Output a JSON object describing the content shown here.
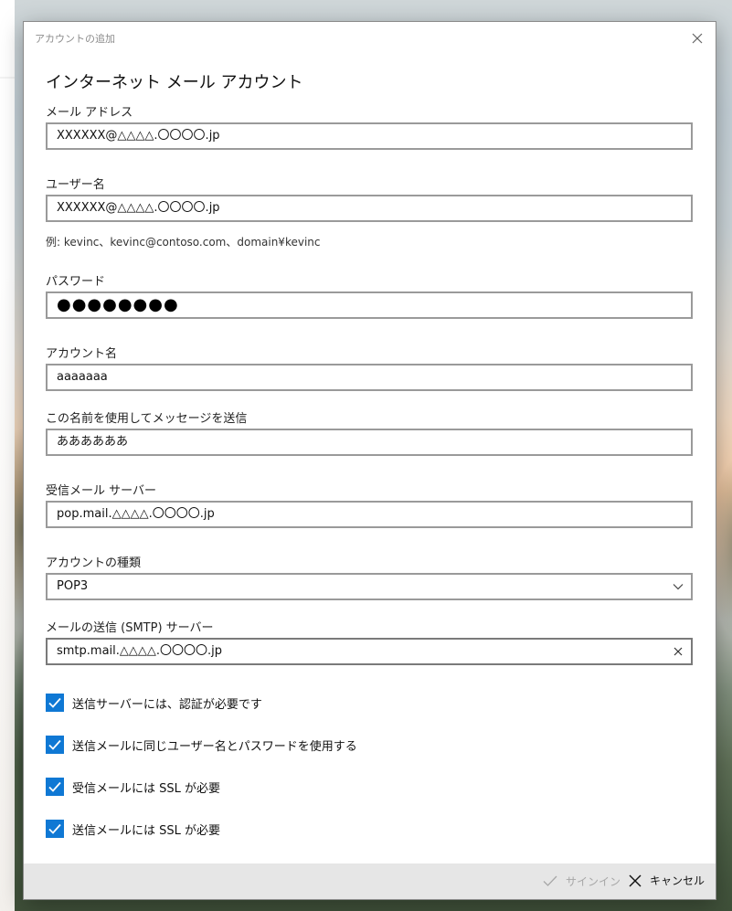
{
  "window": {
    "title": "アカウントの追加"
  },
  "dialog": {
    "heading": "インターネット メール アカウント",
    "fields": {
      "email": {
        "label": "メール アドレス",
        "value": "XXXXXX@△△△△.〇〇〇〇.jp"
      },
      "username": {
        "label": "ユーザー名",
        "value": "XXXXXX@△△△△.〇〇〇〇.jp",
        "hint": "例: kevinc、kevinc@contoso.com、domain¥kevinc"
      },
      "password": {
        "label": "パスワード",
        "value": "●●●●●●●●"
      },
      "account_name": {
        "label": "アカウント名",
        "value": "aaaaaaa"
      },
      "sender_name": {
        "label": "この名前を使用してメッセージを送信",
        "value": "ああああああ"
      },
      "incoming_server": {
        "label": "受信メール サーバー",
        "value": "pop.mail.△△△△.〇〇〇〇.jp"
      },
      "account_type": {
        "label": "アカウントの種類",
        "value": "POP3"
      },
      "smtp_server": {
        "label": "メールの送信 (SMTP) サーバー",
        "value": "smtp.mail.△△△△.〇〇〇〇.jp"
      }
    },
    "checkboxes": [
      {
        "label": "送信サーバーには、認証が必要です",
        "checked": true
      },
      {
        "label": "送信メールに同じユーザー名とパスワードを使用する",
        "checked": true
      },
      {
        "label": "受信メールには SSL が必要",
        "checked": true
      },
      {
        "label": "送信メールには SSL が必要",
        "checked": true
      }
    ],
    "footer": {
      "signin_label": "サインイン",
      "cancel_label": "キャンセル"
    }
  },
  "colors": {
    "accent": "#0f78d4",
    "footer_bg": "#e6e6e6",
    "field_border": "#9a9a9a",
    "disabled_text": "#a7a7a7"
  },
  "icons": {
    "close": "close-icon",
    "dropdown": "chevron-down-icon",
    "clear": "clear-icon",
    "check": "checkmark-icon",
    "cancel": "close-icon"
  }
}
